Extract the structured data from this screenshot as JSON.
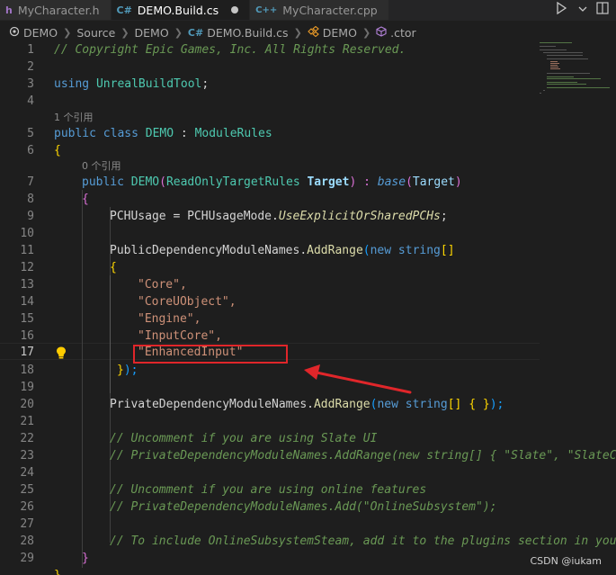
{
  "tabs": [
    {
      "icon": "h",
      "label": "MyCharacter.h",
      "active": false,
      "modified": false
    },
    {
      "icon": "C#",
      "label": "DEMO.Build.cs",
      "active": true,
      "modified": true
    },
    {
      "icon": "C++",
      "label": "MyCharacter.cpp",
      "active": false,
      "modified": false
    }
  ],
  "breadcrumb": [
    "DEMO",
    "Source",
    "DEMO",
    "DEMO.Build.cs",
    "DEMO",
    ".ctor"
  ],
  "breadcrumb_prefix": {
    "csharp": "C#"
  },
  "codelens": {
    "class_refs": "1 个引用",
    "ctor_refs": "0 个引用"
  },
  "lines": {
    "l1": "// Copyright Epic Games, Inc. All Rights Reserved.",
    "l3a": "using",
    "l3b": "UnrealBuildTool",
    "l3c": ";",
    "l5a": "public",
    "l5b": "class",
    "l5c": "DEMO",
    "l5d": " : ",
    "l5e": "ModuleRules",
    "l6": "{",
    "l7a": "public",
    "l7b": "DEMO",
    "l7c": "(",
    "l7d": "ReadOnlyTargetRules",
    "l7e": "Target",
    "l7f": ") : ",
    "l7g": "base",
    "l7h": "(",
    "l7i": "Target",
    "l7j": ")",
    "l8": "{",
    "l9a": "PCHUsage = PCHUsageMode.",
    "l9b": "UseExplicitOrSharedPCHs",
    "l9c": ";",
    "l11a": "PublicDependencyModuleNames.",
    "l11b": "AddRange",
    "l11c": "(",
    "l11d": "new",
    "l11e": "string",
    "l11f": "[]",
    "l12": "{",
    "l13": "\"Core\",",
    "l14": "\"CoreUObject\",",
    "l15": "\"Engine\",",
    "l16": "\"InputCore\",",
    "l17": "\"EnhancedInput\"",
    "l18a": "}",
    "l18b": ");",
    "l20a": "PrivateDependencyModuleNames.",
    "l20b": "AddRange",
    "l20c": "(",
    "l20d": "new",
    "l20e": "string",
    "l20f": "[]",
    "l20g": " { }",
    "l20h": ");",
    "l22": "// Uncomment if you are using Slate UI",
    "l23": "// PrivateDependencyModuleNames.AddRange(new string[] { \"Slate\", \"SlateCo",
    "l25": "// Uncomment if you are using online features",
    "l26": "// PrivateDependencyModuleNames.Add(\"OnlineSubsystem\");",
    "l28": "// To include OnlineSubsystemSteam, add it to the plugins section in you",
    "l29": "}",
    "l30": "}"
  },
  "line_numbers": [
    "1",
    "2",
    "3",
    "4",
    "5",
    "6",
    "7",
    "8",
    "9",
    "10",
    "11",
    "12",
    "13",
    "14",
    "15",
    "16",
    "17",
    "18",
    "19",
    "20",
    "21",
    "22",
    "23",
    "24",
    "25",
    "26",
    "27",
    "28",
    "29"
  ],
  "current_line": "17",
  "watermark": "CSDN @iukam",
  "colors": {
    "highlight_box": "#e0262a",
    "arrow": "#e0262a",
    "background": "#1e1e1e"
  }
}
